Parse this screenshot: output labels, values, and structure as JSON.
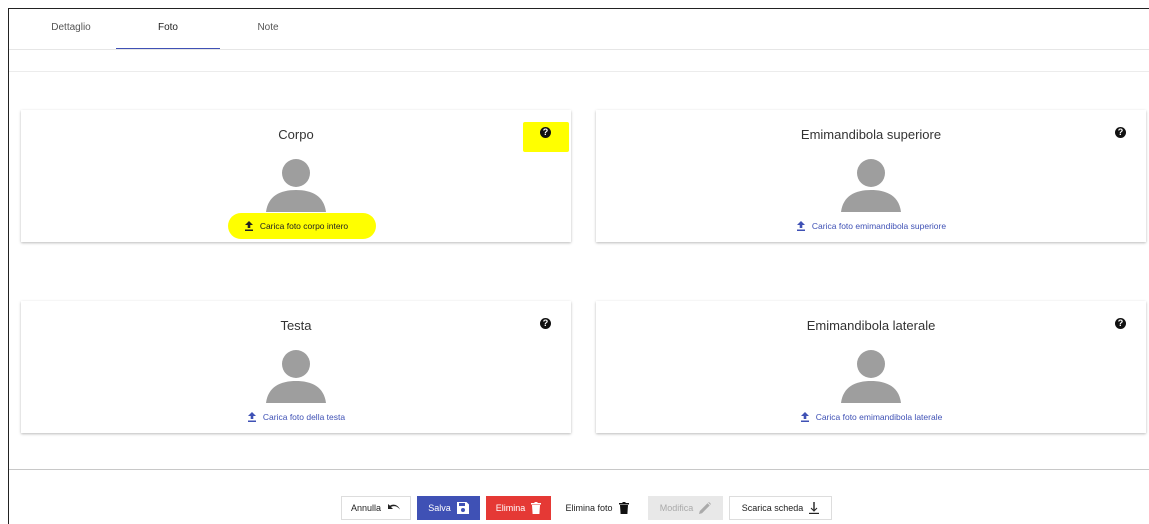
{
  "tabs": [
    {
      "label": "Dettaglio",
      "active": false
    },
    {
      "label": "Foto",
      "active": true
    },
    {
      "label": "Note",
      "active": false
    }
  ],
  "panels": [
    {
      "title": "Corpo",
      "upload_label": "Carica foto corpo intero",
      "highlighted": true
    },
    {
      "title": "Emimandibola superiore",
      "upload_label": "Carica foto emimandibola superiore",
      "highlighted": false
    },
    {
      "title": "Testa",
      "upload_label": "Carica foto della testa",
      "highlighted": false
    },
    {
      "title": "Emimandibola laterale",
      "upload_label": "Carica foto emimandibola laterale",
      "highlighted": false
    }
  ],
  "help_glyph": "?",
  "toolbar": {
    "annulla": "Annulla",
    "salva": "Salva",
    "elimina": "Elimina",
    "elimina_foto": "Elimina foto",
    "modifica": "Modifica",
    "scarica_scheda": "Scarica scheda"
  },
  "colors": {
    "primary": "#3f51b5",
    "danger": "#e53935",
    "highlight": "#ffff00",
    "avatar": "#9e9e9e"
  },
  "icons": {
    "help": "question-circle-icon",
    "upload": "upload-icon",
    "avatar": "person-placeholder-icon",
    "undo": "undo-icon",
    "save": "floppy-disk-icon",
    "delete": "trash-icon",
    "edit": "pencil-icon",
    "download": "download-icon"
  }
}
